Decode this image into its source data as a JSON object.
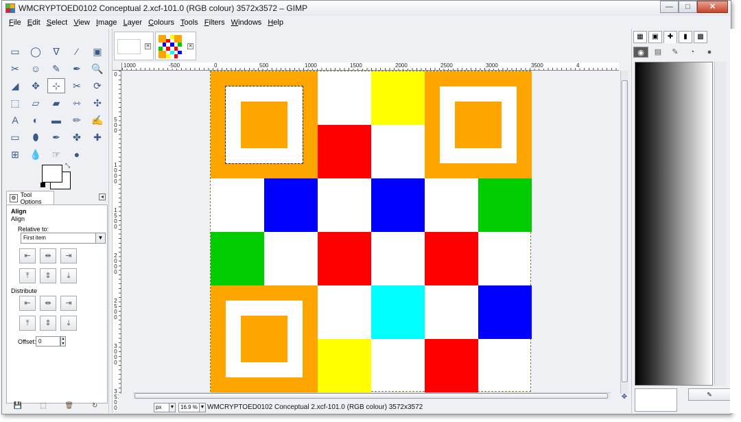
{
  "window": {
    "title": "WMCRYPTOED0102 Conceptual 2.xcf-101.0 (RGB colour) 3572x3572 – GIMP",
    "controls": {
      "minimize": "—",
      "maximize": "□",
      "close": "✕"
    }
  },
  "menu": [
    {
      "key": "F",
      "rest": "ile"
    },
    {
      "key": "E",
      "rest": "dit"
    },
    {
      "key": "S",
      "rest": "elect"
    },
    {
      "key": "V",
      "rest": "iew"
    },
    {
      "key": "I",
      "rest": "mage"
    },
    {
      "key": "L",
      "rest": "ayer"
    },
    {
      "key": "C",
      "rest": "olours"
    },
    {
      "key": "T",
      "rest": "ools"
    },
    {
      "key": "F",
      "rest": "ilters"
    },
    {
      "key": "W",
      "rest": "indows"
    },
    {
      "key": "H",
      "rest": "elp"
    }
  ],
  "toolbox": {
    "tools": [
      "rect-select",
      "ellipse-select",
      "free-select",
      "fuzzy-select",
      "select-by-color",
      "scissors",
      "foreground-select",
      "paths",
      "color-picker",
      "zoom",
      "measure",
      "move",
      "align",
      "crop",
      "rotate",
      "scale",
      "shear",
      "perspective",
      "flip",
      "cage-transform",
      "text",
      "bucket-fill",
      "blend",
      "pencil",
      "paintbrush",
      "eraser",
      "airbrush",
      "ink",
      "clone",
      "heal",
      "perspective-clone",
      "blur",
      "smudge",
      "dodge-burn"
    ],
    "icon_glyphs": [
      "▭",
      "◯",
      "ᐁ",
      "⁄",
      "▣",
      "✂",
      "☺",
      "✎",
      "✒",
      "🔍",
      "◢",
      "✥",
      "⊹",
      "✂",
      "⟳",
      "⬚",
      "▱",
      "▰",
      "⇿",
      "✣",
      "A",
      "◐",
      "▬",
      "✏",
      "✍",
      "▭",
      "⬮",
      "✒",
      "✤",
      "✚",
      "⊞",
      "💧",
      "☞",
      "●"
    ],
    "active_index": 12
  },
  "tool_options": {
    "tab_label": "Tool Options",
    "title": "Align",
    "subtitle": "Align",
    "relative_to_label": "Relative to:",
    "relative_to_value": "First item",
    "distribute_label": "Distribute",
    "offset_label": "Offset:",
    "offset_value": "0",
    "align_buttons": [
      "⇤",
      "⇹",
      "⇥",
      "⤒",
      "⇕",
      "⤓"
    ],
    "distribute_buttons": [
      "⇤",
      "⇹",
      "⇥",
      "⤒",
      "⇕",
      "⤓"
    ]
  },
  "toolbox_bottom": [
    "💾",
    "⬚",
    "🗑",
    "↻"
  ],
  "image_window": {
    "rulers": {
      "top": [
        "1000",
        "-500",
        "0",
        "500",
        "1000",
        "1500",
        "2000",
        "2500",
        "3000",
        "3500",
        "4"
      ],
      "left": [
        "0",
        "500",
        "1000",
        "1500",
        "2000",
        "2500",
        "3000",
        "3500"
      ]
    },
    "status": {
      "unit": "px",
      "zoom": "16.9 %",
      "text": "WMCRYPTOED0102 Conceptual 2.xcf-101.0 (RGB colour) 3572x3572"
    },
    "colors": {
      "orange": "#ffa500",
      "red": "#ff0000",
      "blue": "#0000ff",
      "green": "#00cc00",
      "yellow": "#ffff00",
      "cyan": "#00ffff",
      "white": "#ffffff"
    },
    "cells": [
      {
        "row": 0,
        "col": 3,
        "color": "#ffff00"
      },
      {
        "row": 1,
        "col": 2,
        "color": "#ff0000"
      },
      {
        "row": 2,
        "col": 1,
        "color": "#0000ff"
      },
      {
        "row": 2,
        "col": 3,
        "color": "#0000ff"
      },
      {
        "row": 2,
        "col": 5,
        "color": "#00cc00"
      },
      {
        "row": 3,
        "col": 0,
        "color": "#00cc00"
      },
      {
        "row": 3,
        "col": 2,
        "color": "#ff0000"
      },
      {
        "row": 3,
        "col": 4,
        "color": "#ff0000"
      },
      {
        "row": 4,
        "col": 3,
        "color": "#00ffff"
      },
      {
        "row": 4,
        "col": 5,
        "color": "#0000ff"
      },
      {
        "row": 5,
        "col": 2,
        "color": "#ffff00"
      },
      {
        "row": 5,
        "col": 4,
        "color": "#ff0000"
      }
    ],
    "finders": [
      {
        "row": 0,
        "col": 0,
        "selected": true
      },
      {
        "row": 0,
        "col": 4,
        "selected": false
      },
      {
        "row": 4,
        "col": 0,
        "selected": false
      }
    ]
  },
  "right_dock": {
    "tabs": [
      "▦",
      "▣",
      "✚",
      "▮",
      "▩"
    ],
    "row2": [
      "◉",
      "▤",
      "✎",
      "◔",
      "●"
    ],
    "bottom_button": "✎"
  }
}
